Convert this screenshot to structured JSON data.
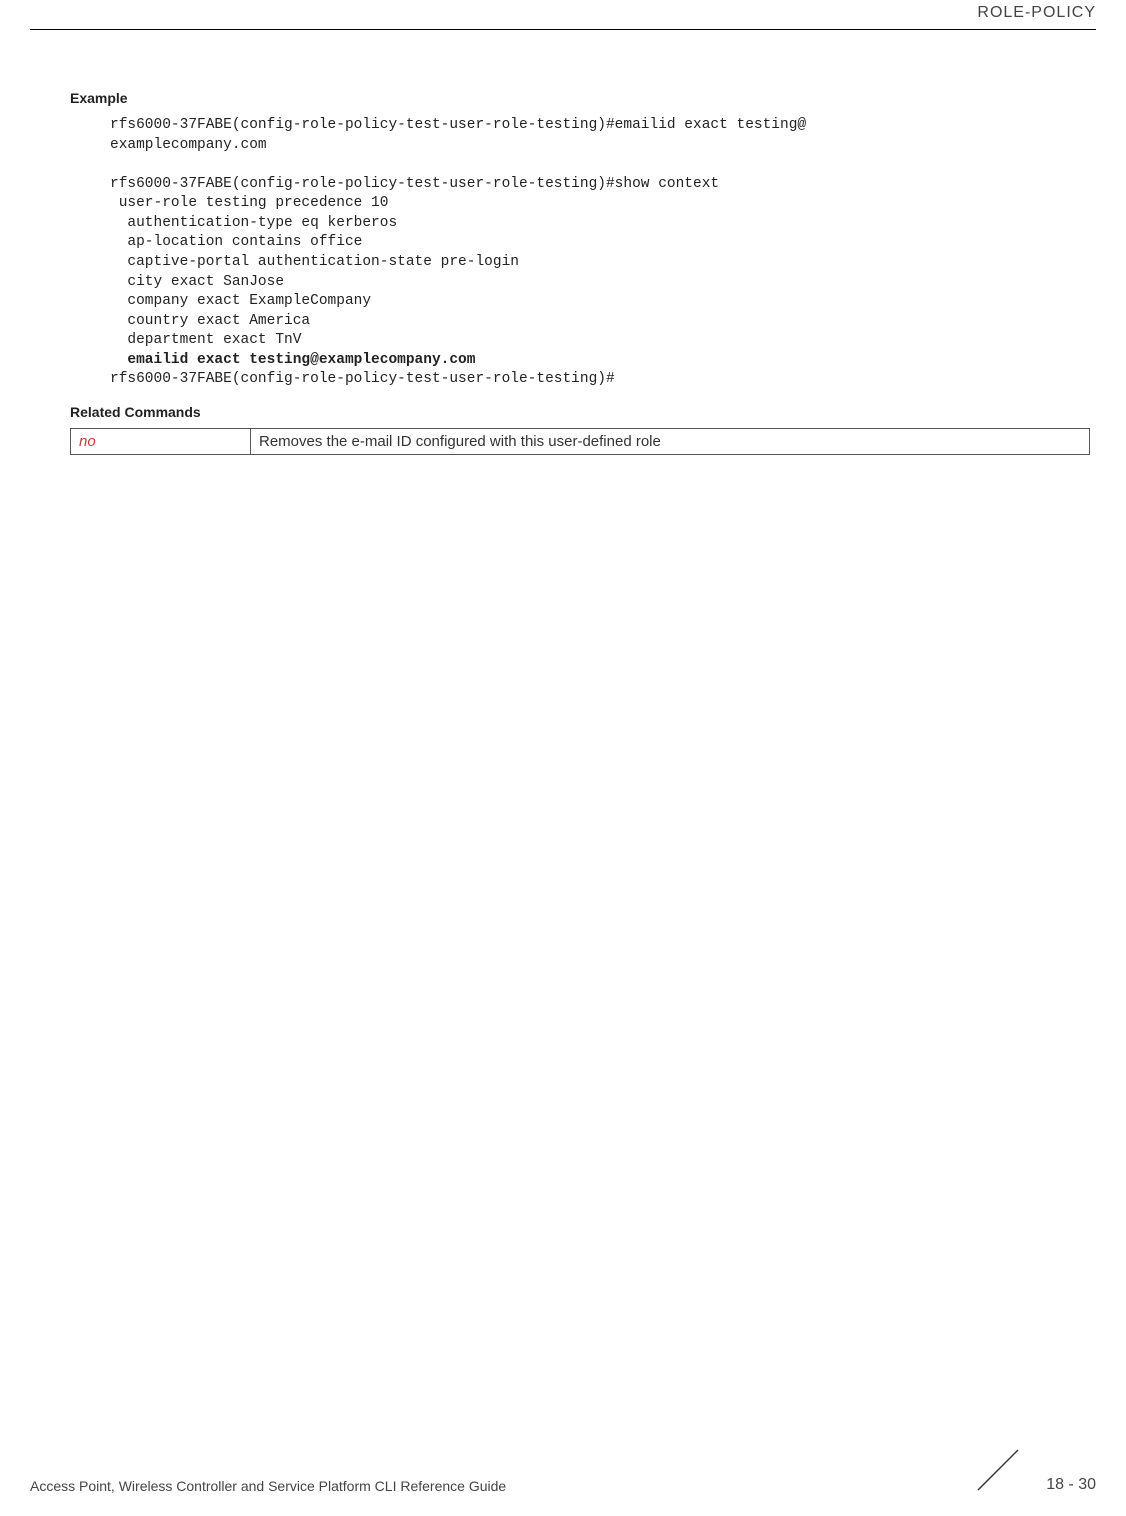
{
  "header": {
    "title": "ROLE-POLICY"
  },
  "example": {
    "heading": "Example",
    "code_line1": "rfs6000-37FABE(config-role-policy-test-user-role-testing)#emailid exact testing@",
    "code_line2": "examplecompany.com",
    "code_line3": "",
    "code_line4": "rfs6000-37FABE(config-role-policy-test-user-role-testing)#show context",
    "code_line5": " user-role testing precedence 10",
    "code_line6": "  authentication-type eq kerberos",
    "code_line7": "  ap-location contains office",
    "code_line8": "  captive-portal authentication-state pre-login",
    "code_line9": "  city exact SanJose",
    "code_line10": "  company exact ExampleCompany",
    "code_line11": "  country exact America",
    "code_line12": "  department exact TnV",
    "code_line13_bold": "  emailid exact testing@examplecompany.com",
    "code_line14": "rfs6000-37FABE(config-role-policy-test-user-role-testing)#"
  },
  "related": {
    "heading": "Related Commands",
    "cmd_name": "no",
    "cmd_desc": "Removes the e-mail ID configured with this user-defined role"
  },
  "footer": {
    "text": "Access Point, Wireless Controller and Service Platform CLI Reference Guide",
    "page": "18 - 30"
  }
}
